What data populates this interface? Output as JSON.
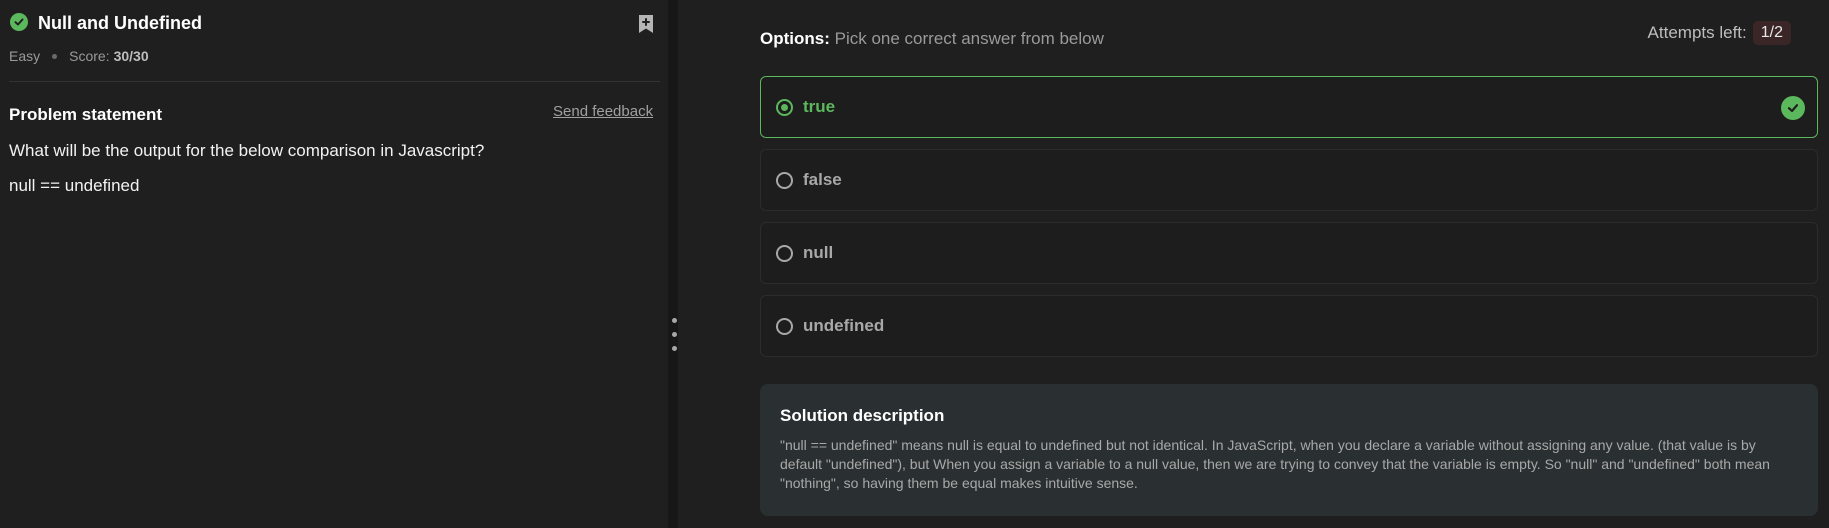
{
  "problem": {
    "title": "Null and Undefined",
    "difficulty": "Easy",
    "score_label": "Score:",
    "score_value": "30/30",
    "statement_heading": "Problem statement",
    "feedback_link": "Send feedback",
    "question": "What will be the output for the below comparison in Javascript?",
    "code": "null == undefined"
  },
  "options": {
    "label": "Options:",
    "instruction": "Pick one correct answer from below",
    "attempts_label": "Attempts left:",
    "attempts_value": "1/2",
    "items": [
      {
        "label": "true",
        "selected": true,
        "correct": true
      },
      {
        "label": "false",
        "selected": false
      },
      {
        "label": "null",
        "selected": false
      },
      {
        "label": "undefined",
        "selected": false
      }
    ]
  },
  "solution": {
    "heading": "Solution description",
    "text": "\"null == undefined\" means null is equal to undefined but not identical. In JavaScript, when you declare a variable without assigning any value. (that value is by default \"undefined\"), but When you assign a variable to a null value, then we are trying to convey that the variable is empty. So \"null\" and \"undefined\" both mean \"nothing\", so having them be equal makes intuitive sense."
  },
  "colors": {
    "accent_green": "#5cb85c",
    "background": "#1f1f1f",
    "solution_bg": "#2a3031",
    "attempts_badge": "#3a2527"
  },
  "icons": [
    "check-circle-icon",
    "bookmark-add-icon",
    "radio-icon",
    "correct-check-icon",
    "drag-handle-icon"
  ]
}
